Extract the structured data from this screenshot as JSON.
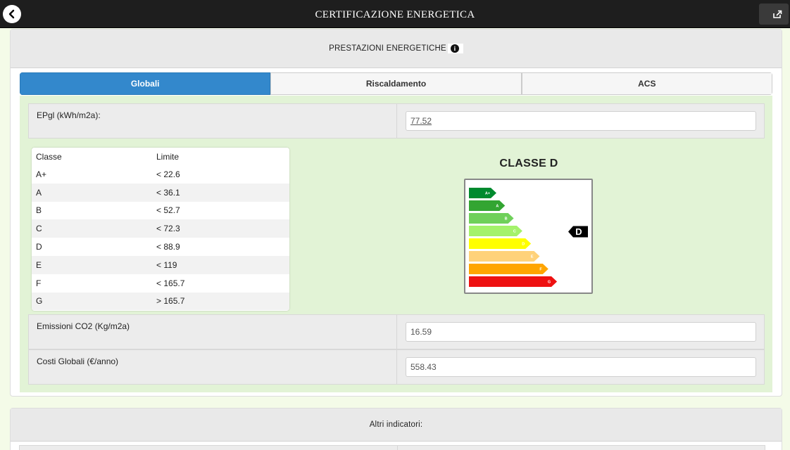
{
  "header": {
    "title": "CERTIFICAZIONE ENERGETICA",
    "back_icon": "chevron-left-icon",
    "share_icon": "share-icon"
  },
  "section_title": "PRESTAZIONI ENERGETICHE",
  "tabs": [
    {
      "label": "Globali",
      "active": true
    },
    {
      "label": "Riscaldamento",
      "active": false
    },
    {
      "label": "ACS",
      "active": false
    }
  ],
  "fields": {
    "epgl": {
      "label": "EPgl (kWh/m2a):",
      "value": "77.52"
    },
    "co2": {
      "label": "Emissioni CO2 (Kg/m2a)",
      "value": "16.59"
    },
    "costi": {
      "label": "Costi Globali (€/anno)",
      "value": "558.43"
    }
  },
  "limits": {
    "headers": [
      "Classe",
      "Limite"
    ],
    "rows": [
      [
        "A+",
        "< 22.6"
      ],
      [
        "A",
        "< 36.1"
      ],
      [
        "B",
        "< 52.7"
      ],
      [
        "C",
        "< 72.3"
      ],
      [
        "D",
        "< 88.9"
      ],
      [
        "E",
        "< 119"
      ],
      [
        "F",
        "< 165.7"
      ],
      [
        "G",
        "> 165.7"
      ]
    ]
  },
  "classe": {
    "title": "CLASSE D",
    "current": "D",
    "bars": [
      {
        "label": "A+",
        "color": "#008a2e"
      },
      {
        "label": "A",
        "color": "#33a532"
      },
      {
        "label": "B",
        "color": "#6fd05a"
      },
      {
        "label": "C",
        "color": "#a4f26b"
      },
      {
        "label": "D",
        "color": "#ffff00"
      },
      {
        "label": "E",
        "color": "#ffd27a"
      },
      {
        "label": "F",
        "color": "#ffa500"
      },
      {
        "label": "G",
        "color": "#ee1111"
      }
    ]
  },
  "altri": {
    "title": "Altri indicatori:"
  },
  "colors": {
    "accent": "#3388cc",
    "panel_green": "#e2f3d6",
    "topbar": "#1e1e1e"
  }
}
